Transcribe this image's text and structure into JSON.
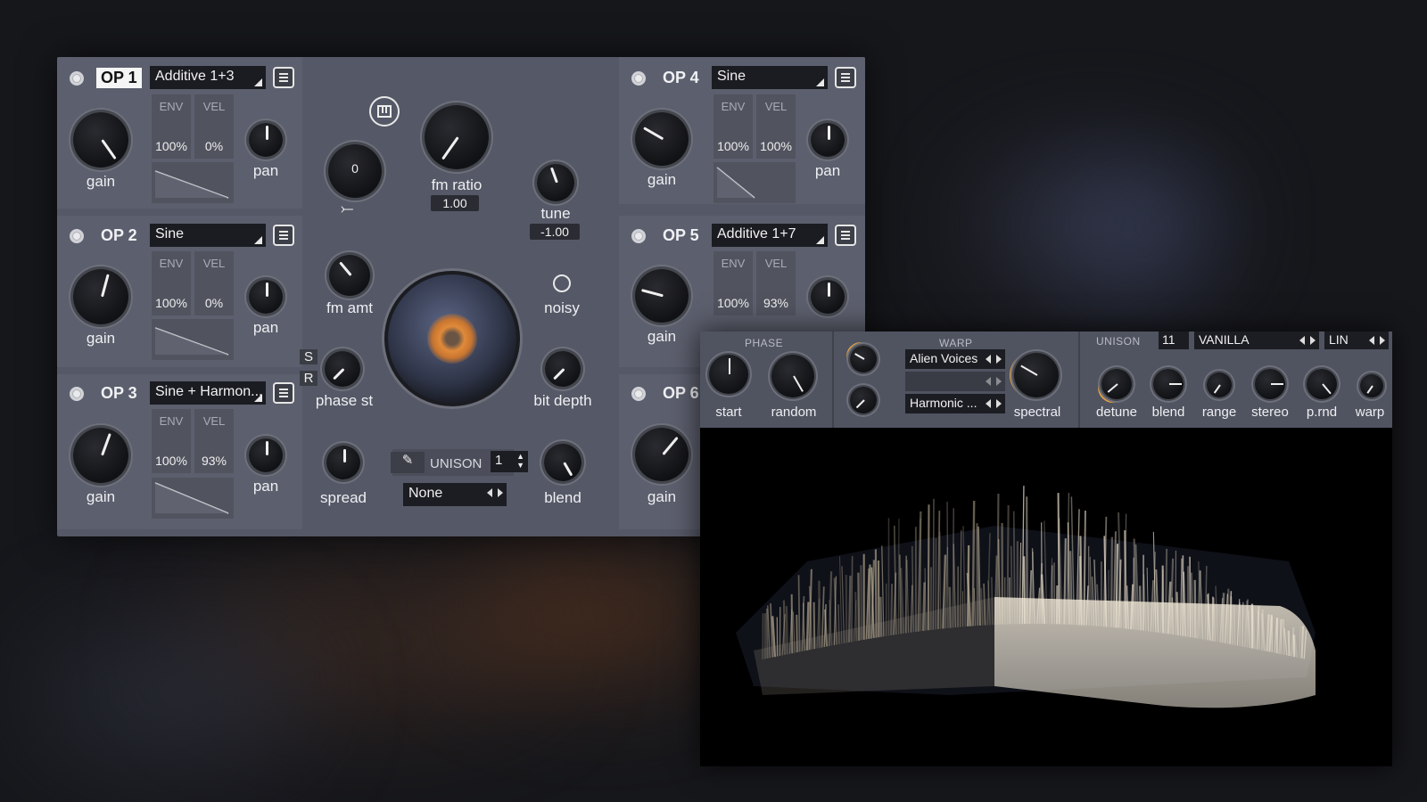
{
  "operators_left": [
    {
      "label": "OP 1",
      "selected": true,
      "waveform": "Additive 1+3",
      "env_label": "ENV",
      "env_value": "100%",
      "vel_label": "VEL",
      "vel_value": "0%",
      "gain_label": "gain",
      "pan_label": "pan"
    },
    {
      "label": "OP 2",
      "selected": false,
      "waveform": "Sine",
      "env_label": "ENV",
      "env_value": "100%",
      "vel_label": "VEL",
      "vel_value": "0%",
      "gain_label": "gain",
      "pan_label": "pan"
    },
    {
      "label": "OP 3",
      "selected": false,
      "waveform": "Sine + Harmon...",
      "env_label": "ENV",
      "env_value": "100%",
      "vel_label": "VEL",
      "vel_value": "93%",
      "gain_label": "gain",
      "pan_label": "pan"
    }
  ],
  "operators_right": [
    {
      "label": "OP 4",
      "waveform": "Sine",
      "env_label": "ENV",
      "env_value": "100%",
      "vel_label": "VEL",
      "vel_value": "100%",
      "gain_label": "gain",
      "pan_label": "pan"
    },
    {
      "label": "OP 5",
      "waveform": "Additive 1+7",
      "env_label": "ENV",
      "env_value": "100%",
      "vel_label": "VEL",
      "vel_value": "93%",
      "gain_label": "gain"
    },
    {
      "label": "OP 6",
      "gain_label": "gain"
    }
  ],
  "center": {
    "transpose_value": "0",
    "fm_ratio_label": "fm ratio",
    "fm_ratio_value": "1.00",
    "tune_label": "tune",
    "tune_value": "-1.00",
    "fm_amt_label": "fm amt",
    "noisy_label": "noisy",
    "phase_st_label": "phase st",
    "bit_depth_label": "bit depth",
    "s_label": "S",
    "r_label": "R",
    "spread_label": "spread",
    "unison_label": "UNISON",
    "unison_value": "1",
    "unison_mode": "None",
    "blend_label": "blend"
  },
  "overlay": {
    "phase_title": "PHASE",
    "start_label": "start",
    "random_label": "random",
    "warp_title": "WARP",
    "warp_mode_1": "Alien Voices",
    "warp_mode_2": "",
    "warp_mode_3": "Harmonic ...",
    "spectral_label": "spectral",
    "unison_title": "UNISON",
    "unison_voices": "11",
    "unison_mode": "VANILLA",
    "unison_curve": "LIN",
    "detune_label": "detune",
    "blend_label": "blend",
    "range_label": "range",
    "stereo_label": "stereo",
    "prnd_label": "p.rnd",
    "warp_label": "warp"
  },
  "colors": {
    "accent": "#e8a23a",
    "panel": "#555866",
    "section": "#5c5f6d",
    "knob": "#141518"
  },
  "icons": [
    "menu-icon",
    "keyboard-icon",
    "route-icon",
    "pencil-icon",
    "arrows-icon",
    "dropdown-triangle-icon"
  ]
}
